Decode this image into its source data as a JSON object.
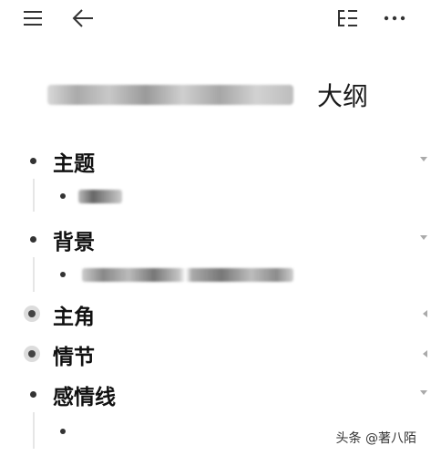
{
  "toolbar": {
    "menu_icon": "hamburger-menu-icon",
    "back_icon": "back-arrow-icon",
    "outline_icon": "outline-list-icon",
    "more_icon": "more-horizontal-icon"
  },
  "document": {
    "title_suffix": "大纲"
  },
  "outline": [
    {
      "label": "主题",
      "expanded": true,
      "has_children": true
    },
    {
      "label": "背景",
      "expanded": true,
      "has_children": true
    },
    {
      "label": "主角",
      "expanded": false,
      "has_children": true
    },
    {
      "label": "情节",
      "expanded": false,
      "has_children": true
    },
    {
      "label": "感情线",
      "expanded": true,
      "has_children": true
    }
  ],
  "watermark": "头条 @著八陌",
  "colors": {
    "text": "#1a1a1a",
    "bullet": "#333333",
    "ring": "#dcdcdc",
    "caret": "#aaaaaa"
  }
}
